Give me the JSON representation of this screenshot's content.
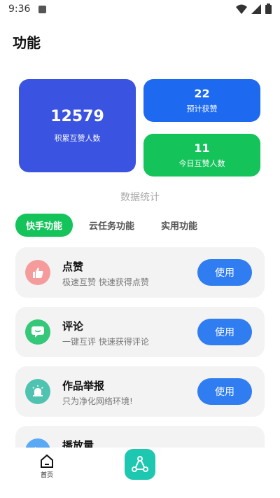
{
  "status_bar": {
    "time": "9:36"
  },
  "page_title": "功能",
  "stats": {
    "total_value": "12579",
    "total_label": "积累互赞人数",
    "expected_value": "22",
    "expected_label": "预计获赞",
    "today_value": "11",
    "today_label": "今日互赞人数",
    "caption": "数据统计"
  },
  "tabs": [
    {
      "label": "快手功能",
      "active": true
    },
    {
      "label": "云任务功能",
      "active": false
    },
    {
      "label": "实用功能",
      "active": false
    }
  ],
  "features": [
    {
      "title": "点赞",
      "desc": "极速互赞 快速获得点赞",
      "button": "使用",
      "icon": "thumbs-up-icon",
      "color": "#f59b9b"
    },
    {
      "title": "评论",
      "desc": "一键互评 快速获得评论",
      "button": "使用",
      "icon": "comment-icon",
      "color": "#35c77a"
    },
    {
      "title": "作品举报",
      "desc": "只为净化网络环境!",
      "button": "使用",
      "icon": "alarm-icon",
      "color": "#4fc3b0"
    },
    {
      "title": "播放量",
      "desc": "",
      "button": "",
      "icon": "play-icon",
      "color": "#5aa9f5"
    }
  ],
  "bottom_nav": {
    "home_label": "首页"
  }
}
